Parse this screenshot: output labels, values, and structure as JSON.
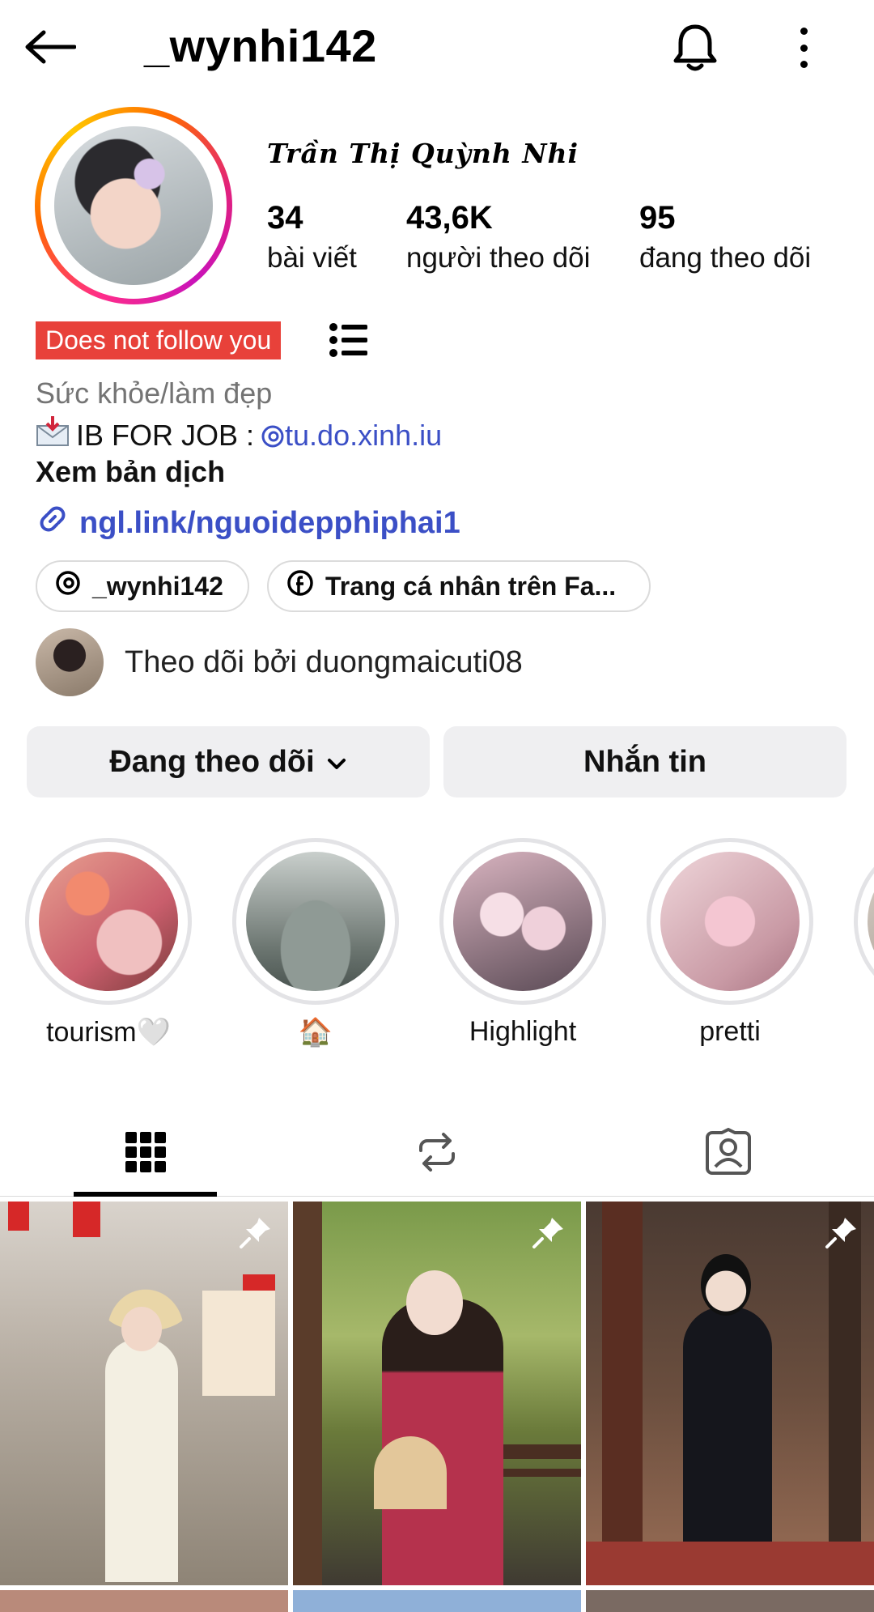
{
  "header": {
    "username": "_wynhi142",
    "icons": [
      "back-arrow-icon",
      "bell-icon",
      "more-vertical-icon"
    ]
  },
  "profile": {
    "display_name": "Trần Thị Quỳnh Nhi",
    "stats": [
      {
        "num": "34",
        "label": "bài viết"
      },
      {
        "num": "43,6K",
        "label": "người theo dõi"
      },
      {
        "num": "95",
        "label": "đang theo dõi"
      }
    ],
    "badge": "Does not follow you",
    "category": "Sức khỏe/làm đẹp",
    "bio_prefix": "IB FOR JOB :",
    "bio_mention": "tu.do.xinh.iu",
    "translate": "Xem bản dịch",
    "link": "ngl.link/nguoidepphiphai1",
    "pills": [
      {
        "label": "_wynhi142",
        "icon": "threads-icon"
      },
      {
        "label": "Trang cá nhân trên Fa...",
        "icon": "facebook-icon"
      }
    ],
    "followed_by": "Theo dõi bởi duongmaicuti08"
  },
  "actions": {
    "following": "Đang theo dõi",
    "message": "Nhắn tin"
  },
  "highlights": [
    {
      "label": "tourism🤍"
    },
    {
      "label": "🏠"
    },
    {
      "label": "Highlight"
    },
    {
      "label": "pretti"
    }
  ],
  "colors": {
    "badge_bg": "#e8413a",
    "link": "#3b4fc6",
    "button_bg": "#efeff1"
  }
}
